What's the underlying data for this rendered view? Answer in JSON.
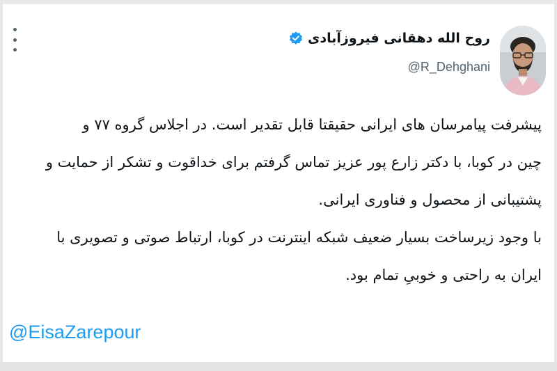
{
  "author": {
    "display_name": "روح الله دهقانی فیروزآبادی",
    "handle": "@R_Dehghani",
    "verified": true,
    "avatar_icon": "profile-photo"
  },
  "menu": {
    "more_icon": "vertical-ellipsis-icon"
  },
  "tweet": {
    "lines": [
      "پیشرفت پیامرسان های ایرانی حقیقتا قابل تقدیر است. در اجلاس گروه ۷۷ و",
      "چین در کوبا، با دکتر زارع پور عزیز تماس گرفتم برای خداقوت و تشکر از حمایت و",
      "پشتیبانی از محصول و فناوری ایرانی.",
      "با وجود زیرساخت بسیار ضعیف شبکه اینترنت در کوبا، ارتباط صوتی و تصویری با",
      "ایران به راحتی و خوبیِ تمام بود."
    ],
    "mention": "@EisaZarepour"
  },
  "colors": {
    "text": "#0f1419",
    "secondary_text": "#536471",
    "link": "#1d9bf0",
    "verified_badge": "#1d9bf0"
  }
}
